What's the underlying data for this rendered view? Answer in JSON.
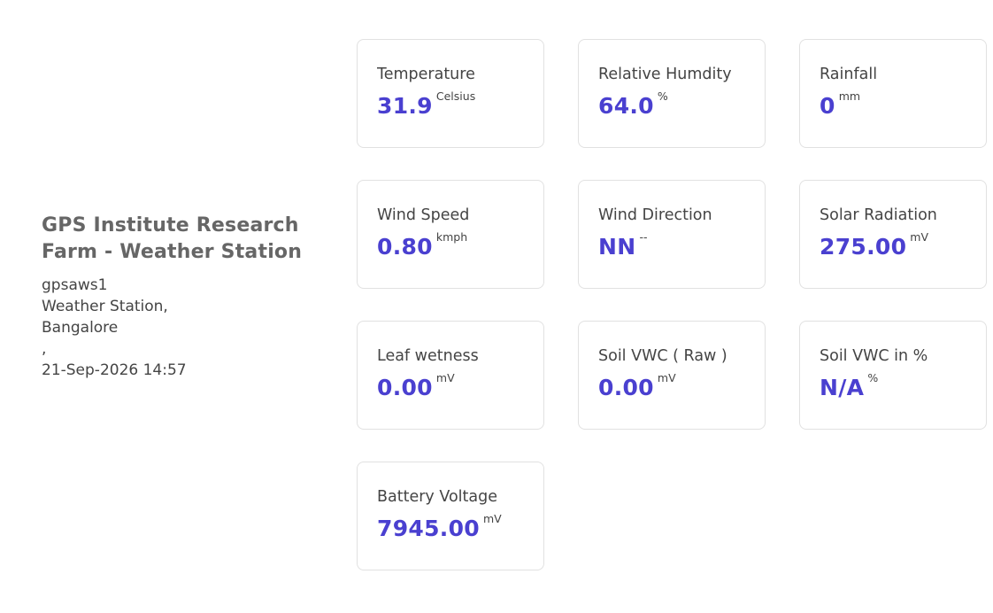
{
  "station": {
    "title": "GPS Institute Research Farm - Weather Station",
    "id": "gpsaws1",
    "type": "Weather Station,",
    "city": "Bangalore",
    "separator": ",",
    "timestamp": "21-Sep-2026 14:57"
  },
  "colors": {
    "value": "#4a40d0",
    "border": "#e1e1e1",
    "title": "#666666"
  },
  "cards": [
    {
      "label": "Temperature",
      "value": "31.9",
      "unit": "Celsius"
    },
    {
      "label": "Relative Humdity",
      "value": "64.0",
      "unit": "%"
    },
    {
      "label": "Rainfall",
      "value": "0",
      "unit": "mm"
    },
    {
      "label": "Wind Speed",
      "value": "0.80",
      "unit": "kmph"
    },
    {
      "label": "Wind Direction",
      "value": "NN",
      "unit": "--"
    },
    {
      "label": "Solar Radiation",
      "value": "275.00",
      "unit": "mV"
    },
    {
      "label": "Leaf wetness",
      "value": "0.00",
      "unit": "mV"
    },
    {
      "label": "Soil VWC ( Raw )",
      "value": "0.00",
      "unit": "mV"
    },
    {
      "label": "Soil VWC in %",
      "value": "N/A",
      "unit": "%"
    },
    {
      "label": "Battery Voltage",
      "value": "7945.00",
      "unit": "mV"
    }
  ]
}
